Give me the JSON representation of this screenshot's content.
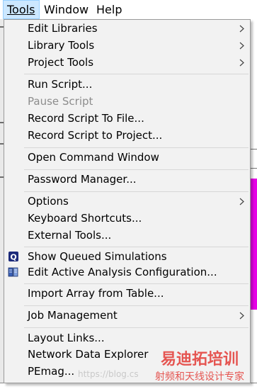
{
  "menubar": {
    "items": [
      {
        "label": "Tools",
        "active": true
      },
      {
        "label": "Window",
        "active": false
      },
      {
        "label": "Help",
        "active": false
      }
    ]
  },
  "menu": {
    "items": [
      {
        "label": "Edit Libraries",
        "submenu": true
      },
      {
        "label": "Library Tools",
        "submenu": true
      },
      {
        "label": "Project Tools",
        "submenu": true
      },
      {
        "label": "Run Script..."
      },
      {
        "label": "Pause Script",
        "disabled": true
      },
      {
        "label": "Record Script To File..."
      },
      {
        "label": "Record Script to Project..."
      },
      {
        "label": "Open Command Window"
      },
      {
        "label": "Password Manager..."
      },
      {
        "label": "Options",
        "submenu": true
      },
      {
        "label": "Keyboard Shortcuts..."
      },
      {
        "label": "External Tools..."
      },
      {
        "label": "Show Queued Simulations",
        "icon": "queue-q-icon"
      },
      {
        "label": "Edit Active Analysis Configuration...",
        "icon": "analysis-config-icon"
      },
      {
        "label": "Import Array from Table..."
      },
      {
        "label": "Job Management",
        "submenu": true
      },
      {
        "label": "Layout Links..."
      },
      {
        "label": "Network Data Explorer"
      },
      {
        "label": "PEmag..."
      }
    ]
  },
  "watermark": {
    "url": "https://blog.cs",
    "logo_line1": "易迪拓培训",
    "logo_line2": "射频和天线设计专家"
  },
  "colors": {
    "menu_bg": "#f2f2f2",
    "menubar_active_bg": "#cce8ff",
    "disabled_text": "#8d8d8d",
    "watermark_red": "#e0201b"
  }
}
